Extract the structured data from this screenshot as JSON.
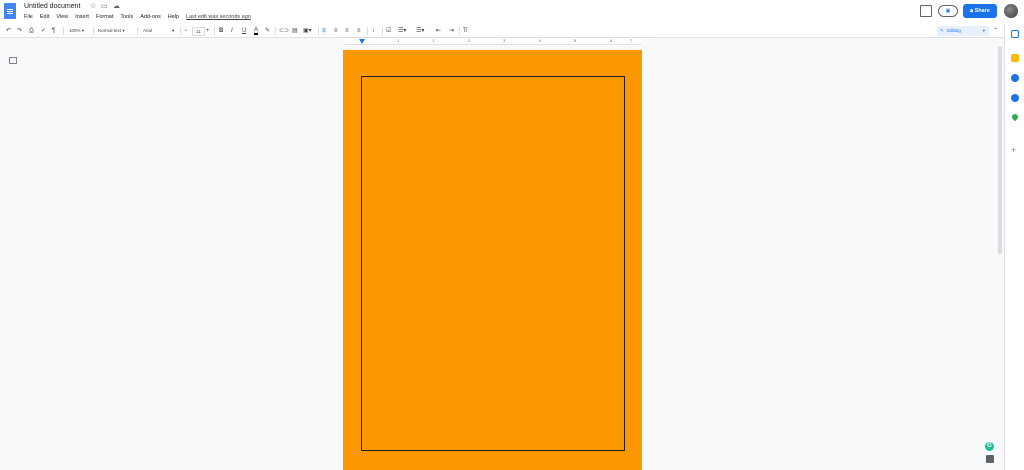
{
  "header": {
    "title": "Untitled document",
    "menu": [
      "File",
      "Edit",
      "View",
      "Insert",
      "Format",
      "Tools",
      "Add-ons",
      "Help"
    ],
    "last_edit": "Last edit was seconds ago",
    "share_label": "Share"
  },
  "toolbar": {
    "zoom": "100%",
    "style": "Normal text",
    "font": "Arial",
    "font_size": "11",
    "bold": "B",
    "italic": "I",
    "underline": "U",
    "text_color": "A",
    "mode": "Editing"
  },
  "ruler": {
    "labels": [
      "1",
      "1",
      "2",
      "3",
      "4",
      "5",
      "6",
      "7"
    ]
  },
  "page": {
    "background": "#fb9800",
    "border_color": "#202124"
  },
  "colors": {
    "accent": "#1a73e8",
    "page_orange": "#fb9800"
  }
}
